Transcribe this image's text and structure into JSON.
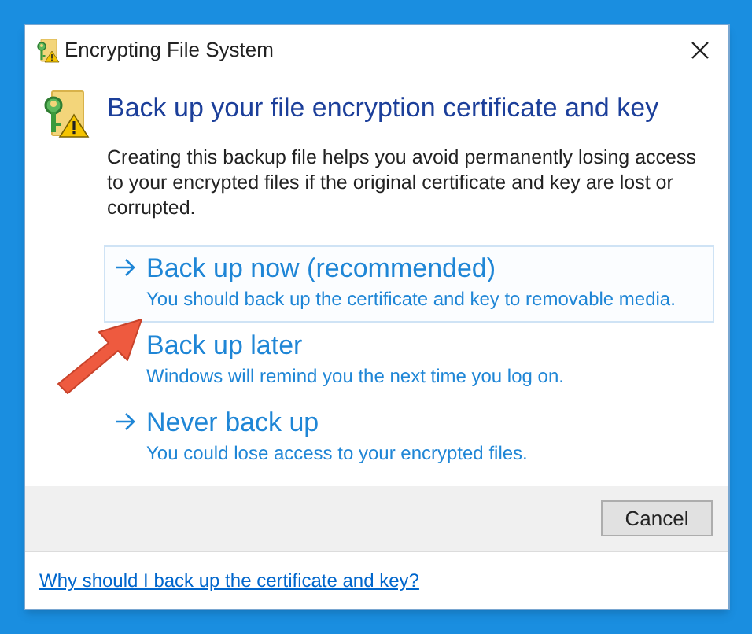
{
  "window": {
    "title": "Encrypting File System"
  },
  "heading": "Back up your file encryption certificate and key",
  "description": "Creating this backup file helps you avoid permanently losing access to your encrypted files if the original certificate and key are lost or corrupted.",
  "options": [
    {
      "title": "Back up now (recommended)",
      "detail": "You should back up the certificate and key to removable media.",
      "selected": true,
      "arrow_hidden": false
    },
    {
      "title": "Back up later",
      "detail": "Windows will remind you the next time you log on.",
      "selected": false,
      "arrow_hidden": true
    },
    {
      "title": "Never back up",
      "detail": "You could lose access to your encrypted files.",
      "selected": false,
      "arrow_hidden": false
    }
  ],
  "buttons": [
    "Cancel"
  ],
  "help_link": "Why should I back up the certificate and key?"
}
